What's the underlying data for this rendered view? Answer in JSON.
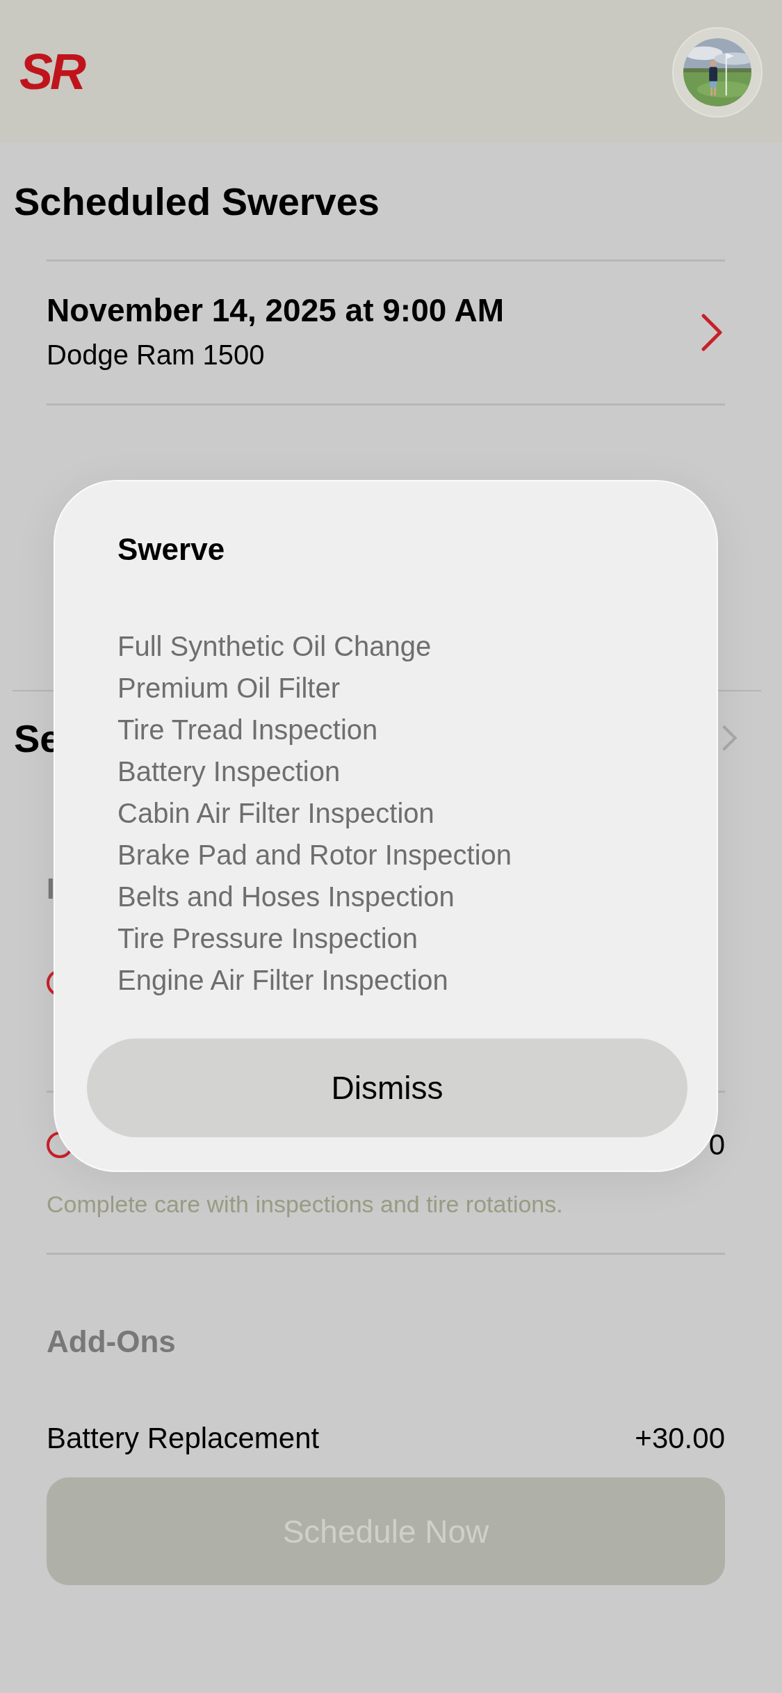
{
  "header": {
    "logo": "SR"
  },
  "scheduled": {
    "title": "Scheduled Swerves",
    "items": [
      {
        "date": "November 14, 2025 at 9:00 AM",
        "vehicle": "Dodge Ram 1500"
      }
    ]
  },
  "background": {
    "section_heading": "Se",
    "subheading": "I",
    "plans": [
      {
        "kind": "plan"
      },
      {
        "kind": "plan",
        "price": "0",
        "description": "Complete care with inspections and tire rotations."
      }
    ],
    "addons_heading": "Add-Ons",
    "addons": [
      {
        "name": "Battery Replacement",
        "price": "+30.00"
      }
    ],
    "schedule_button": {
      "label": "Schedule Now",
      "disabled": true
    }
  },
  "modal": {
    "title": "Swerve",
    "items": [
      "Full Synthetic Oil Change",
      "Premium Oil Filter",
      "Tire Tread Inspection",
      "Battery Inspection",
      "Cabin Air Filter Inspection",
      "Brake Pad and Rotor Inspection",
      "Belts and Hoses Inspection",
      "Tire Pressure Inspection",
      "Engine Air Filter Inspection"
    ],
    "button": "Dismiss"
  }
}
